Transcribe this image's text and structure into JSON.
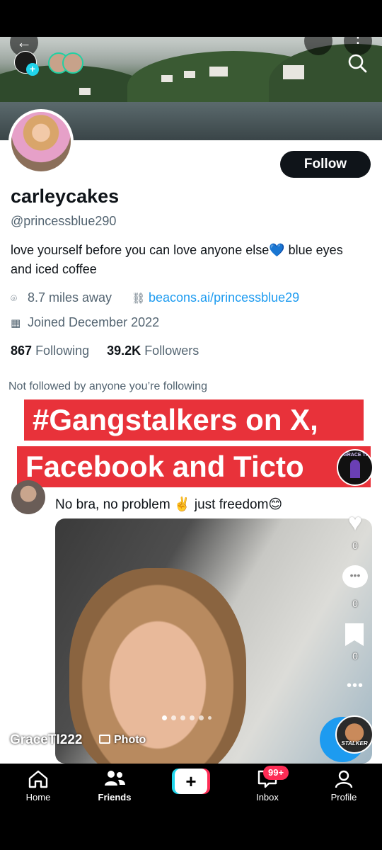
{
  "profile": {
    "follow_label": "Follow",
    "display_name": "carleycakes",
    "handle": "@princessblue290",
    "bio": "love yourself before you can love anyone else💙 blue eyes and iced coffee",
    "location": "8.7 miles away",
    "website": "beacons.ai/princessblue29",
    "joined": "Joined December 2022",
    "following_count": "867",
    "following_label": "Following",
    "followers_count": "39.2K",
    "followers_label": "Followers",
    "not_followed": "Not followed by anyone you’re following"
  },
  "overlay": {
    "line1": "#Gangstalkers on X,",
    "line2": "Facebook and Ticto",
    "badge_text": "GRACE TI",
    "stalker_label": "STALKER"
  },
  "post": {
    "text": "No bra, no problem ✌️ just freedom😊",
    "likes": "0",
    "comments": "0",
    "bookmarks": "0"
  },
  "tiktok": {
    "author": "GraceTI222",
    "media_type": "Photo",
    "slide_index": 1,
    "slide_count": 6
  },
  "nav": {
    "home": "Home",
    "friends": "Friends",
    "inbox": "Inbox",
    "inbox_badge": "99+",
    "profile": "Profile",
    "create": "+"
  },
  "colors": {
    "follow_bg": "#0f1419",
    "link": "#1d9bf0",
    "overlay_red": "#e8323a",
    "tiktok_cyan": "#20d5ec",
    "tiktok_red": "#fe2c55"
  }
}
